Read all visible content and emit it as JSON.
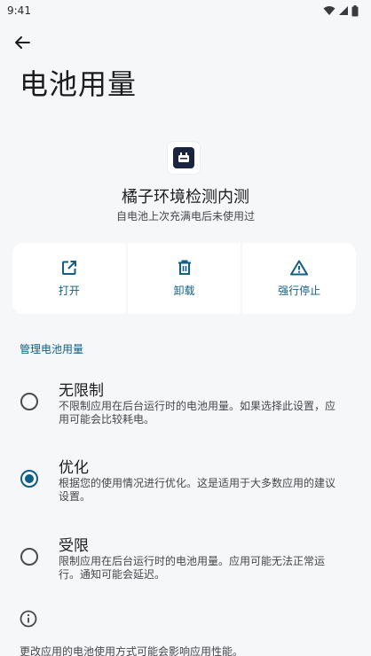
{
  "status_bar": {
    "time": "9:41",
    "icons": [
      "wifi-icon",
      "signal-icon",
      "battery-icon"
    ]
  },
  "header": {
    "back_icon": "arrow-left-icon",
    "title": "电池用量"
  },
  "app": {
    "icon": "app-icon",
    "name": "橘子环境检测内测",
    "subtitle": "自电池上次充满电后未使用过"
  },
  "actions": [
    {
      "label": "打开",
      "icon": "open-external-icon"
    },
    {
      "label": "卸载",
      "icon": "trash-icon"
    },
    {
      "label": "强行停止",
      "icon": "warning-triangle-icon"
    }
  ],
  "battery_section": {
    "label": "管理电池用量",
    "options": [
      {
        "title": "无限制",
        "desc": "不限制应用在后台运行时的电池用量。如果选择此设置，应用可能会比较耗电。",
        "selected": false
      },
      {
        "title": "优化",
        "desc": "根据您的使用情况进行优化。这是适用于大多数应用的建议设置。",
        "selected": true
      },
      {
        "title": "受限",
        "desc": "限制应用在后台运行时的电池用量。应用可能无法正常运行。通知可能会延迟。",
        "selected": false
      }
    ]
  },
  "footer": {
    "info_icon": "info-icon",
    "text": "更改应用的电池使用方式可能会影响应用性能。"
  },
  "colors": {
    "accent": "#0f5e85",
    "background": "#f6f7f9",
    "card": "#ffffff"
  }
}
